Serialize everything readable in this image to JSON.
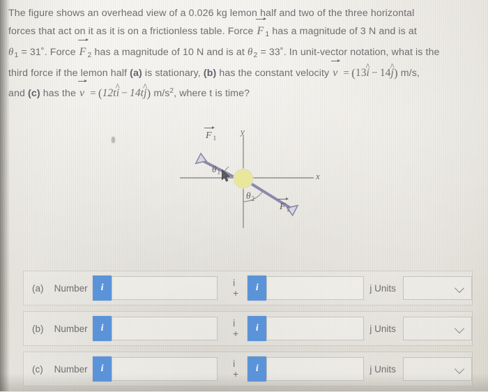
{
  "problem": {
    "line1": "The figure shows an overhead view of a 0.026 kg lemon half and two of the three horizontal",
    "line2_a": "forces that act on it as it is on a frictionless table. Force",
    "force1_symbol": "F",
    "force1_sub": "1",
    "line2_b": "has a magnitude of 3 N and is at",
    "theta1_label": "θ",
    "theta1_sub": "1",
    "theta1_value": "= 31˚.",
    "line3_a": "Force",
    "force2_symbol": "F",
    "force2_sub": "2",
    "line3_b": "has a magnitude of 10 N and is at",
    "theta2_label": "θ",
    "theta2_sub": "2",
    "theta2_value": "= 33˚.",
    "line3_c": "In unit-vector notation, what is the",
    "line4_a": "third force if the lemon half",
    "part_a_tag": "(a)",
    "line4_b": "is stationary,",
    "part_b_tag": "(b)",
    "line4_c": "has the constant velocity",
    "velocity_symbol": "v",
    "equals": "=",
    "vel_b_open": "(",
    "vel_b_i": "13",
    "vel_b_ihat": "i",
    "vel_b_minus": "−",
    "vel_b_j": "14",
    "vel_b_jhat": "j",
    "vel_b_close": ")",
    "vel_b_units": "m/s,",
    "line5_a": "and",
    "part_c_tag": "(c)",
    "line5_b": "has the",
    "vel_c_open": "(",
    "vel_c_i": "12t",
    "vel_c_ihat": "i",
    "vel_c_minus": "−",
    "vel_c_j": "14t",
    "vel_c_jhat": "j",
    "vel_c_close": ")",
    "vel_c_units": "m/s",
    "vel_c_sup": "2",
    "line5_c": ", where t is time?"
  },
  "figure": {
    "x_axis_label": "x",
    "y_axis_label": "y",
    "force1_label": "F",
    "force1_sub": "1",
    "force2_label": "F",
    "force2_sub": "2",
    "theta1_label": "θ",
    "theta1_sub": "1",
    "theta2_label": "θ",
    "theta2_sub": "2",
    "colors": {
      "lemon_fill": "#e8e79a",
      "lemon_stroke": "#c9c77e",
      "arrow": "#8b89a8",
      "axis": "#8b8b88"
    }
  },
  "answers": {
    "info_icon_label": "i",
    "number_label": "Number",
    "operator_label": "i +",
    "units_label": "j Units",
    "field_value": "",
    "select_value": "",
    "rows": [
      {
        "tag": "(a)"
      },
      {
        "tag": "(b)"
      },
      {
        "tag": "(c)"
      }
    ]
  }
}
